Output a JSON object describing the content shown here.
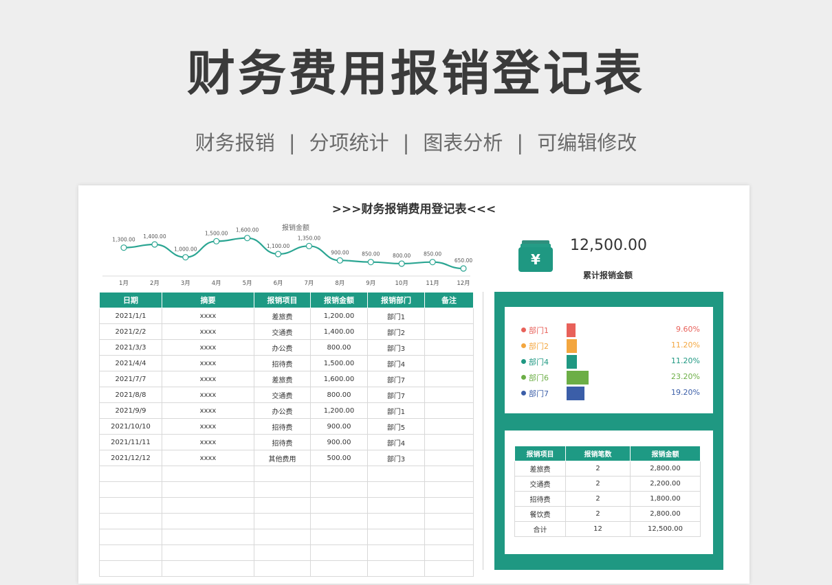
{
  "hero": {
    "title": "财务费用报销登记表",
    "tags": [
      "财务报销",
      "分项统计",
      "图表分析",
      "可编辑修改"
    ],
    "separator": "|"
  },
  "sheet_title": ">>>财务报销费用登记表<<<",
  "chart_data": {
    "type": "line",
    "title": "报销金额",
    "categories": [
      "1月",
      "2月",
      "3月",
      "4月",
      "5月",
      "6月",
      "7月",
      "8月",
      "9月",
      "10月",
      "11月",
      "12月"
    ],
    "series": [
      {
        "values": [
          1300,
          1400,
          1000,
          1500,
          1600,
          1100,
          1350,
          900,
          850,
          800,
          850,
          650
        ]
      }
    ],
    "data_labels": [
      "1,300.00",
      "1,400.00",
      "1,000.00",
      "1,500.00",
      "1,600.00",
      "1,100.00",
      "1,350.00",
      "900.00",
      "850.00",
      "800.00",
      "850.00",
      "650.00"
    ],
    "ylim": [
      0,
      1800
    ],
    "color": "#2aa592",
    "grid": false,
    "legend": "none"
  },
  "main_table": {
    "headers": [
      "日期",
      "摘要",
      "报销项目",
      "报销金额",
      "报销部门",
      "备注"
    ],
    "rows": [
      [
        "2021/1/1",
        "xxxx",
        "差旅费",
        "1,200.00",
        "部门1",
        ""
      ],
      [
        "2021/2/2",
        "xxxx",
        "交通费",
        "1,400.00",
        "部门2",
        ""
      ],
      [
        "2021/3/3",
        "xxxx",
        "办公费",
        "800.00",
        "部门3",
        ""
      ],
      [
        "2021/4/4",
        "xxxx",
        "招待费",
        "1,500.00",
        "部门4",
        ""
      ],
      [
        "2021/7/7",
        "xxxx",
        "差旅费",
        "1,600.00",
        "部门7",
        ""
      ],
      [
        "2021/8/8",
        "xxxx",
        "交通费",
        "800.00",
        "部门7",
        ""
      ],
      [
        "2021/9/9",
        "xxxx",
        "办公费",
        "1,200.00",
        "部门1",
        ""
      ],
      [
        "2021/10/10",
        "xxxx",
        "招待费",
        "900.00",
        "部门5",
        ""
      ],
      [
        "2021/11/11",
        "xxxx",
        "招待费",
        "900.00",
        "部门4",
        ""
      ],
      [
        "2021/12/12",
        "xxxx",
        "其他费用",
        "500.00",
        "部门3",
        ""
      ],
      [
        "",
        "",
        "",
        "",
        "",
        ""
      ],
      [
        "",
        "",
        "",
        "",
        "",
        ""
      ],
      [
        "",
        "",
        "",
        "",
        "",
        ""
      ],
      [
        "",
        "",
        "",
        "",
        "",
        ""
      ],
      [
        "",
        "",
        "",
        "",
        "",
        ""
      ],
      [
        "",
        "",
        "",
        "",
        "",
        ""
      ],
      [
        "",
        "",
        "",
        "",
        "",
        ""
      ]
    ]
  },
  "total": {
    "icon": "yen-icon",
    "value": "12,500.00",
    "label": "累计报销金额"
  },
  "dept_stats": [
    {
      "name": "部门1",
      "pct": "9.60%",
      "value": 9.6,
      "color": "#e8615a"
    },
    {
      "name": "部门2",
      "pct": "11.20%",
      "value": 11.2,
      "color": "#f3a63f"
    },
    {
      "name": "部门4",
      "pct": "11.20%",
      "value": 11.2,
      "color": "#1f9882"
    },
    {
      "name": "部门6",
      "pct": "23.20%",
      "value": 23.2,
      "color": "#6cae46"
    },
    {
      "name": "部门7",
      "pct": "19.20%",
      "value": 19.2,
      "color": "#3b5ea8"
    }
  ],
  "summary_table": {
    "headers": [
      "报销项目",
      "报销笔数",
      "报销金额"
    ],
    "rows": [
      [
        "差旅费",
        "2",
        "2,800.00"
      ],
      [
        "交通费",
        "2",
        "2,200.00"
      ],
      [
        "招待费",
        "2",
        "1,800.00"
      ],
      [
        "餐饮费",
        "2",
        "2,800.00"
      ],
      [
        "合计",
        "12",
        "12,500.00"
      ]
    ]
  }
}
